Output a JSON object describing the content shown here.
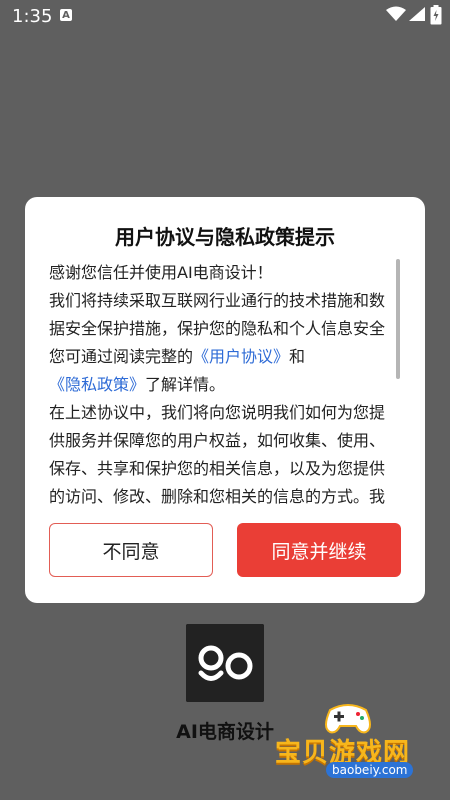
{
  "status_bar": {
    "time": "1:35",
    "notification_icon": "A"
  },
  "dialog": {
    "title": "用户协议与隐私政策提示",
    "intro": "感谢您信任并使用AI电商设计！",
    "para1_a": "我们将持续采取互联网行业通行的技术措施和数据安全保护措施，保护您的隐私和个人信息安全您可通过阅读完整的",
    "link_user_agreement": "《用户协议》",
    "and": "和",
    "link_privacy_policy": "《隐私政策》",
    "para1_b": "了解详情。",
    "para2": "在上述协议中，我们将向您说明我们如何为您提供服务并保障您的用户权益，如何收集、使用、保存、共享和保护您的相关信息，以及为您提供的访问、修改、删除和您相关的信息的方式。我们",
    "disagree_label": "不同意",
    "agree_label": "同意并继续"
  },
  "app": {
    "name": "AI电商设计"
  },
  "watermark": {
    "title": "宝贝游戏网",
    "url": "baobeiy.com"
  },
  "colors": {
    "accent": "#ea3e36",
    "link": "#2e6bd6",
    "overlay": "#5f5f5f"
  }
}
